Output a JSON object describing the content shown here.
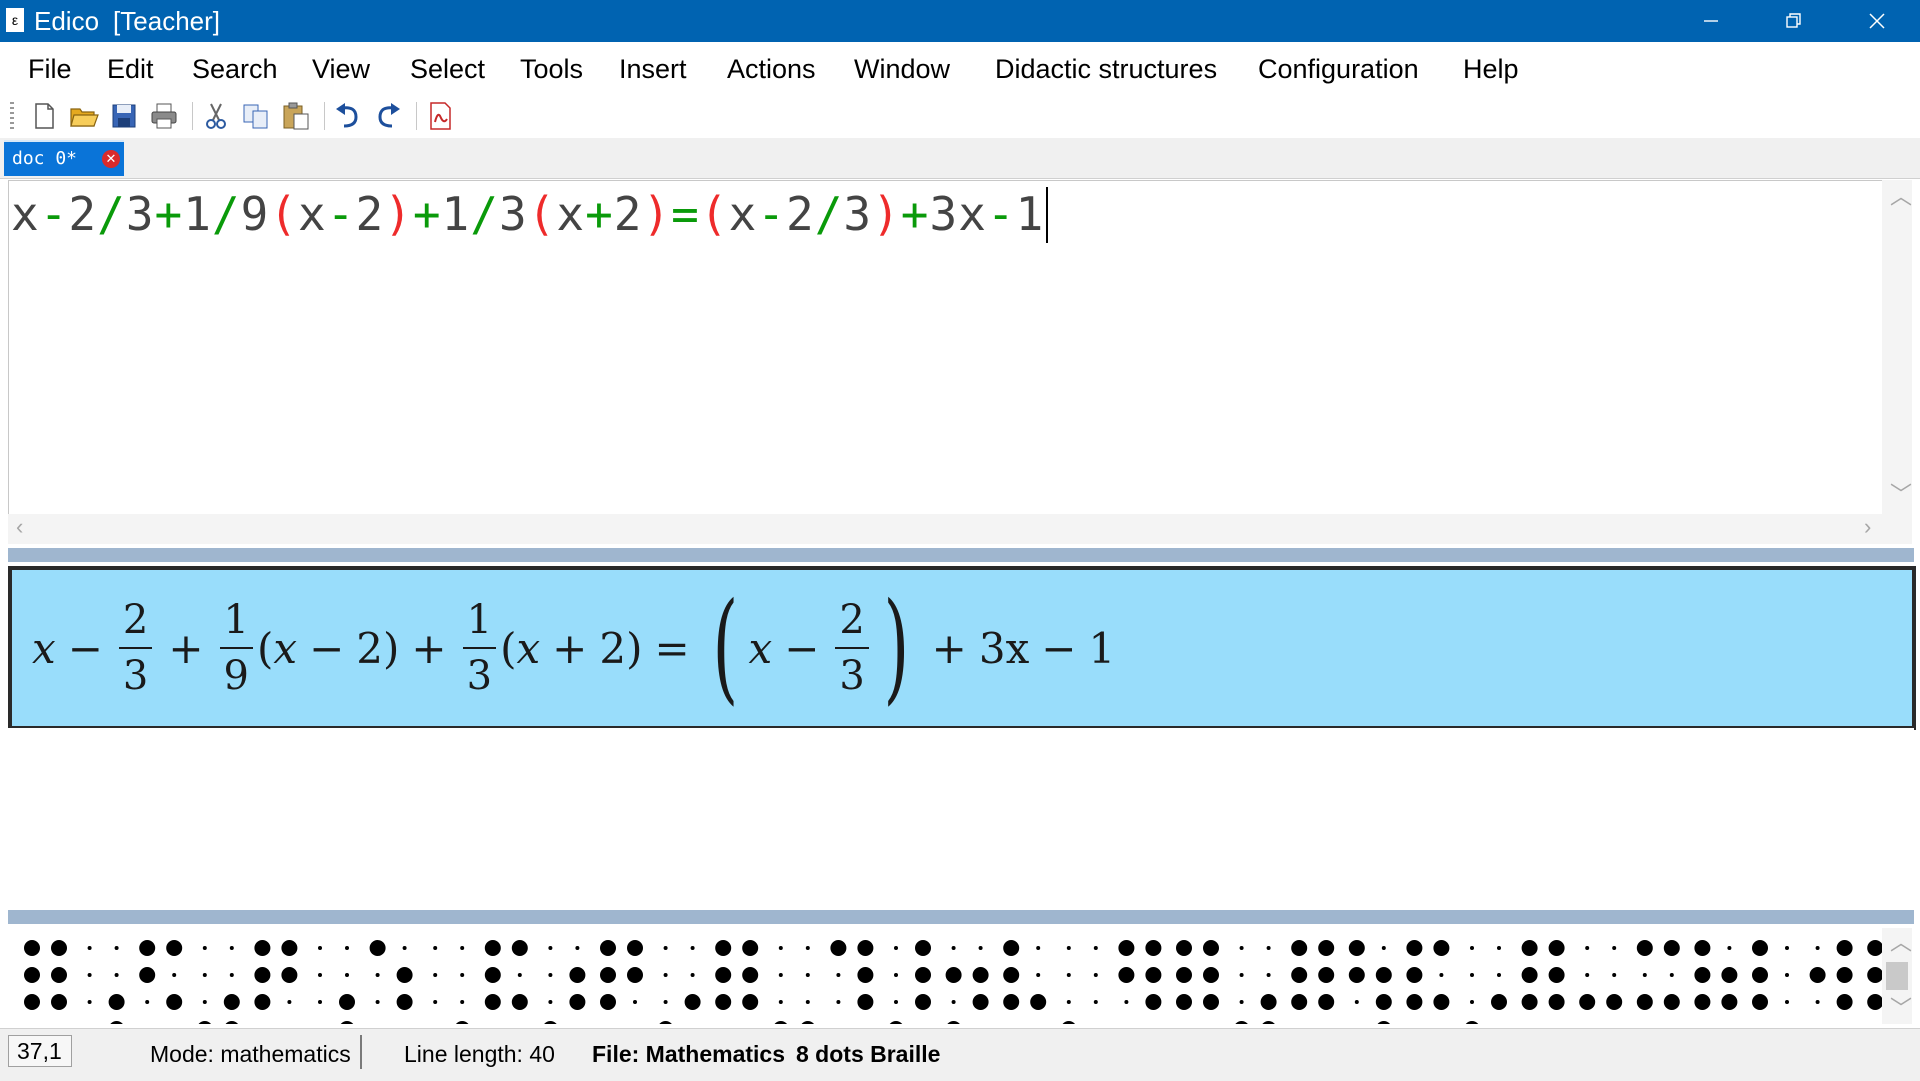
{
  "window": {
    "app_name": "Edico",
    "role": "[Teacher]"
  },
  "menu": [
    "File",
    "Edit",
    "Search",
    "View",
    "Select",
    "Tools",
    "Insert",
    "Actions",
    "Window",
    "Didactic structures",
    "Configuration",
    "Help"
  ],
  "toolbar": {
    "icons": [
      "new-document-icon",
      "open-folder-icon",
      "save-icon",
      "print-icon",
      "cut-icon",
      "copy-icon",
      "paste-icon",
      "undo-icon",
      "redo-icon",
      "pdf-icon"
    ]
  },
  "tab": {
    "label": "doc 0*",
    "close_glyph": "✕"
  },
  "editor": {
    "tokens": [
      {
        "t": "x",
        "c": "black"
      },
      {
        "t": "-",
        "c": "green"
      },
      {
        "t": "2",
        "c": "black"
      },
      {
        "t": "/",
        "c": "green"
      },
      {
        "t": "3",
        "c": "black"
      },
      {
        "t": "+",
        "c": "green"
      },
      {
        "t": "1",
        "c": "black"
      },
      {
        "t": "/",
        "c": "green"
      },
      {
        "t": "9",
        "c": "black"
      },
      {
        "t": "(",
        "c": "red"
      },
      {
        "t": "x",
        "c": "black"
      },
      {
        "t": "-",
        "c": "green"
      },
      {
        "t": "2",
        "c": "black"
      },
      {
        "t": ")",
        "c": "red"
      },
      {
        "t": "+",
        "c": "green"
      },
      {
        "t": "1",
        "c": "black"
      },
      {
        "t": "/",
        "c": "green"
      },
      {
        "t": "3",
        "c": "black"
      },
      {
        "t": "(",
        "c": "red"
      },
      {
        "t": "x",
        "c": "black"
      },
      {
        "t": "+",
        "c": "green"
      },
      {
        "t": "2",
        "c": "black"
      },
      {
        "t": ")",
        "c": "red"
      },
      {
        "t": "=",
        "c": "green"
      },
      {
        "t": "(",
        "c": "red"
      },
      {
        "t": "x",
        "c": "black"
      },
      {
        "t": "-",
        "c": "green"
      },
      {
        "t": "2",
        "c": "black"
      },
      {
        "t": "/",
        "c": "green"
      },
      {
        "t": "3",
        "c": "black"
      },
      {
        "t": ")",
        "c": "red"
      },
      {
        "t": "+",
        "c": "green"
      },
      {
        "t": "3",
        "c": "black"
      },
      {
        "t": "x",
        "c": "black"
      },
      {
        "t": "-",
        "c": "green"
      },
      {
        "t": "1",
        "c": "black"
      }
    ],
    "colors": {
      "black": "#444444",
      "green": "#0a9a0a",
      "red": "#ee2b2b"
    }
  },
  "math": {
    "x": "x",
    "minus": "−",
    "plus": "+",
    "equals": "=",
    "two": "2",
    "three": "3",
    "one": "1",
    "nine": "9",
    "open": "(",
    "close": ")",
    "big_open": "(",
    "big_close": ")",
    "three_x": "3x"
  },
  "braille_cells": [
    [
      1,
      2,
      3,
      4,
      5,
      6
    ],
    [
      6,
      8
    ],
    [
      1,
      2,
      4,
      6
    ],
    [
      6,
      7,
      8
    ],
    [
      1,
      2,
      3,
      4,
      5
    ],
    [
      6,
      8
    ],
    [
      1,
      5,
      6
    ],
    [
      8
    ],
    [
      1,
      2,
      3,
      4,
      6
    ],
    [
      5,
      6,
      7
    ],
    [
      1,
      2,
      3,
      4,
      5
    ],
    [
      6,
      7
    ],
    [
      1,
      2,
      3,
      4,
      5,
      6
    ],
    [
      7,
      8
    ],
    [
      1,
      4,
      5,
      6
    ],
    [
      4,
      5,
      6,
      7
    ],
    [
      2,
      5,
      6,
      7
    ],
    [
      1,
      2,
      3,
      6
    ],
    [
      7
    ],
    [
      1,
      2,
      4,
      5,
      6
    ],
    [
      1,
      2,
      3,
      4,
      5,
      6
    ],
    [
      6,
      7,
      8
    ],
    [
      1,
      2,
      3,
      4,
      5,
      6
    ],
    [
      1,
      2,
      5,
      6,
      8
    ],
    [
      1,
      2,
      3,
      4,
      6
    ],
    [
      6,
      7
    ],
    [
      1,
      2,
      3,
      4,
      5,
      6
    ],
    [
      3,
      6
    ],
    [
      1,
      3,
      4,
      6
    ],
    [
      1,
      2,
      3,
      5,
      6
    ],
    [
      1,
      2,
      3
    ],
    [
      2,
      4,
      5,
      6
    ],
    [
      1,
      2,
      3,
      4,
      5,
      6
    ],
    [
      3,
      7
    ],
    [
      6,
      7
    ],
    [
      6,
      8
    ],
    [
      1,
      2,
      3,
      4,
      5,
      6
    ],
    [
      1,
      3
    ],
    [
      1,
      2,
      4,
      5,
      6
    ],
    [
      6,
      8
    ]
  ],
  "status": {
    "position": "37,1",
    "mode": "Mode: mathematics",
    "line_length": "Line length: 40",
    "file": "File: Mathematics",
    "braille_mode": "8 dots Braille"
  }
}
